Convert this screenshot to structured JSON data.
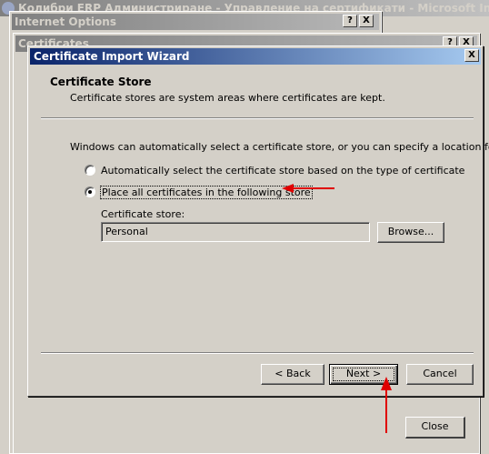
{
  "background_window": {
    "title": "Колибри ERP Администриране - Управление на сертификати - Microsoft Internet E"
  },
  "internet_options": {
    "title": "Internet Options",
    "help_label": "?",
    "close_label": "X"
  },
  "certificates": {
    "title": "Certificates",
    "help_label": "?",
    "close_label": "X",
    "close_button": "Close"
  },
  "wizard": {
    "title": "Certificate Import Wizard",
    "close_label": "X",
    "header_title": "Certificate Store",
    "header_description": "Certificate stores are system areas where certificates are kept.",
    "intro": "Windows can automatically select a certificate store, or you can specify a location for",
    "options": [
      {
        "label": "Automatically select the certificate store based on the type of certificate",
        "checked": false
      },
      {
        "label": "Place all certificates in the following store",
        "checked": true
      }
    ],
    "store_label": "Certificate store:",
    "store_value": "Personal",
    "browse_button": "Browse...",
    "back_button": "< Back",
    "next_button": "Next >",
    "cancel_button": "Cancel"
  },
  "annotations": {
    "arrow_color": "#e00000"
  }
}
